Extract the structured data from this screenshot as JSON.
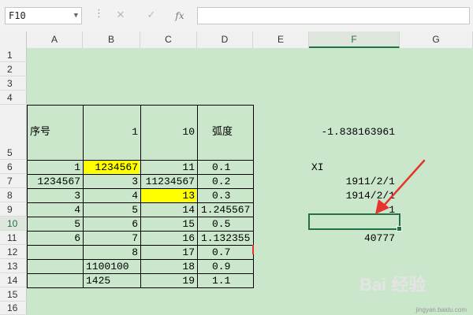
{
  "formula_bar": {
    "name_box": "F10",
    "separator": "⋮",
    "cancel_icon": "✕",
    "enter_icon": "✓",
    "fx_label": "fx",
    "formula": ""
  },
  "columns": [
    "A",
    "B",
    "C",
    "D",
    "E",
    "F",
    "G"
  ],
  "selected_column": "F",
  "rows": [
    "1",
    "2",
    "3",
    "4",
    "5",
    "6",
    "7",
    "8",
    "9",
    "10",
    "11",
    "12",
    "13",
    "14",
    "15",
    "16"
  ],
  "selected_row": "10",
  "header": {
    "a": "序号",
    "b": "1",
    "c": "10",
    "d": "弧度",
    "f": "-1.838163961"
  },
  "table_rows": [
    {
      "a": "1",
      "b": "1234567",
      "c": "11",
      "d": "0.1"
    },
    {
      "a": "1234567",
      "b": "3",
      "c": "11234567",
      "d": "0.2"
    },
    {
      "a": "3",
      "b": "4",
      "c": "13",
      "d": "0.3"
    },
    {
      "a": "4",
      "b": "5",
      "c": "14",
      "d": "1.245567"
    },
    {
      "a": "5",
      "b": "6",
      "c": "15",
      "d": "0.5"
    },
    {
      "a": "6",
      "b": "7",
      "c": "16",
      "d": "1.132355"
    },
    {
      "a": "",
      "b": "8",
      "c": "17",
      "d": "0.7"
    },
    {
      "a": "",
      "b": "1100100",
      "c": "18",
      "d": "0.9"
    },
    {
      "a": "",
      "b": "1425",
      "c": "19",
      "d": "1.1"
    }
  ],
  "column_f": {
    "r6": "XI",
    "r7": "1911/2/1",
    "r8": "1914/2/1",
    "r9": "1",
    "r11": "40777"
  },
  "watermark": {
    "logo": "Bai 经验",
    "url": "jingyan.baidu.com"
  },
  "colors": {
    "sheet_bg": "#cae6cb",
    "highlight": "#ffff00",
    "selection": "#217346",
    "arrow": "#e8332c"
  }
}
